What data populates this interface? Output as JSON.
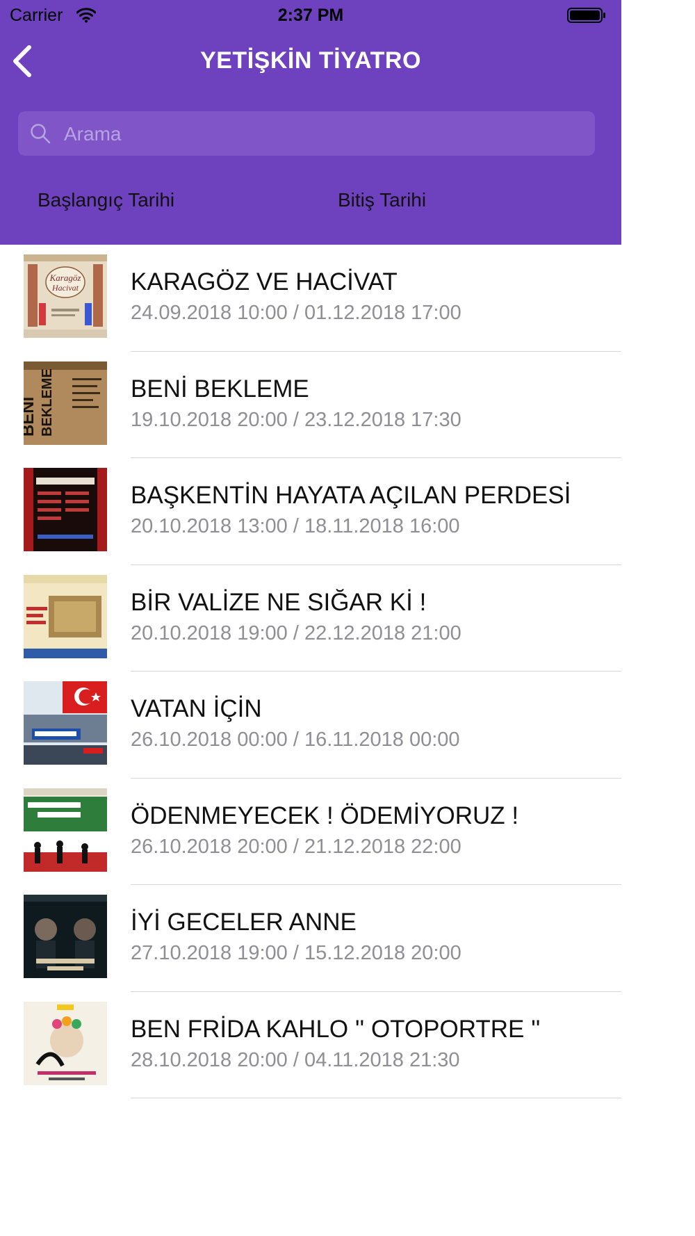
{
  "status_bar": {
    "carrier": "Carrier",
    "time": "2:37 PM"
  },
  "header": {
    "title": "YETİŞKİN TİYATRO"
  },
  "search": {
    "placeholder": "Arama",
    "value": ""
  },
  "date_filter": {
    "start_label": "Başlangıç Tarihi",
    "end_label": "Bitiş Tarihi"
  },
  "colors": {
    "header_bg": "#6e41bf",
    "search_bg": "#7f55c8",
    "divider": "#d6d6da",
    "date_text": "#8e8e93"
  },
  "events": [
    {
      "title": "KARAGÖZ VE HACİVAT",
      "dates": "24.09.2018 10:00 / 01.12.2018 17:00",
      "poster_alt": "Karagöz Hacivat"
    },
    {
      "title": "BENİ BEKLEME",
      "dates": "19.10.2018 20:00 / 23.12.2018 17:30",
      "poster_alt": "BENİ BEKLEME"
    },
    {
      "title": "BAŞKENTİN HAYATA AÇILAN PERDESİ",
      "dates": "20.10.2018 13:00 / 18.11.2018 16:00",
      "poster_alt": "PERDELERİNİ AÇIYOR"
    },
    {
      "title": "BİR VALİZE NE SIĞAR Kİ !",
      "dates": "20.10.2018 19:00 / 22.12.2018 21:00",
      "poster_alt": "BİR VALİZE NE SIĞAR Kİ"
    },
    {
      "title": "VATAN İÇİN",
      "dates": "26.10.2018 00:00 / 16.11.2018 00:00",
      "poster_alt": "VATAN İÇİN"
    },
    {
      "title": "ÖDENMEYECEK ! ÖDEMİYORUZ !",
      "dates": "26.10.2018 20:00 / 21.12.2018 22:00",
      "poster_alt": "ÖDENMEYECEK ÖDEMİYORUZ"
    },
    {
      "title": "İYİ GECELER ANNE",
      "dates": "27.10.2018 19:00 / 15.12.2018 20:00",
      "poster_alt": "İYİ GECELER ANNE"
    },
    {
      "title": "BEN FRİDA KAHLO '' OTOPORTRE ''",
      "dates": "28.10.2018 20:00 / 04.11.2018 21:30",
      "poster_alt": "BEN FRİDA KAHLO OTOPORTRE"
    }
  ]
}
